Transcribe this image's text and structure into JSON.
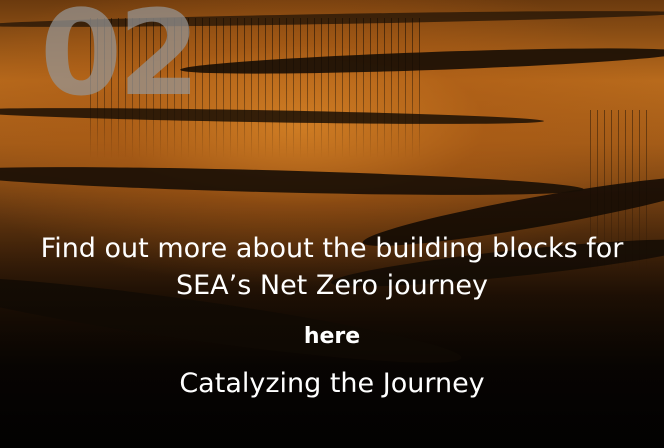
{
  "card": {
    "number": "02",
    "headline": "Find out more about the building blocks for SEA’s Net Zero journey",
    "link_label": "here",
    "subtitle": "Catalyzing the Journey"
  }
}
